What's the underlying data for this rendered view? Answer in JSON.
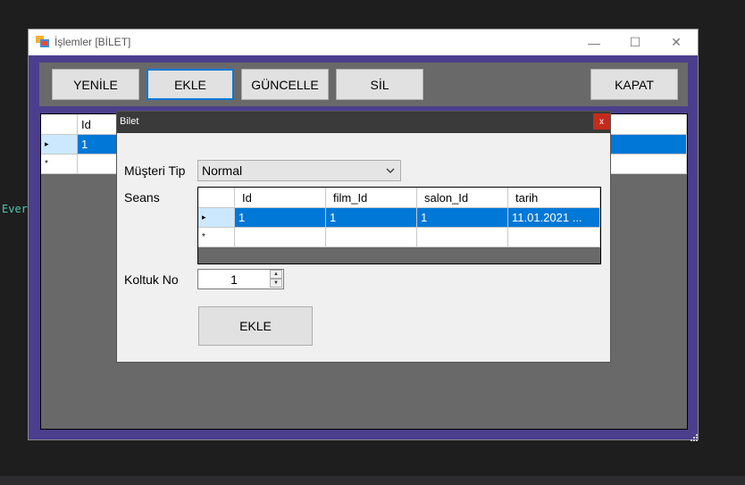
{
  "editor": {
    "snippet": "Ever"
  },
  "window": {
    "title": "İşlemler [BİLET]",
    "minimize": "—",
    "maximize": "☐",
    "close": "✕"
  },
  "toolbar": {
    "yenile": "YENİLE",
    "ekle": "EKLE",
    "guncelle": "GÜNCELLE",
    "sil": "SİL",
    "kapat": "KAPAT"
  },
  "main_grid": {
    "columns": [
      "Id"
    ],
    "rows": [
      [
        "1"
      ]
    ],
    "current_row_marker": "▸",
    "new_row_marker": "*"
  },
  "dialog": {
    "title": "Bilet",
    "close": "x",
    "musteri_label": "Müşteri Tip",
    "musteri_value": "Normal",
    "seans_label": "Seans",
    "seans_grid": {
      "columns": [
        "Id",
        "film_Id",
        "salon_Id",
        "tarih"
      ],
      "rows": [
        [
          "1",
          "1",
          "1",
          "11.01.2021 ..."
        ]
      ],
      "current_row_marker": "▸",
      "new_row_marker": "*"
    },
    "koltuk_label": "Koltuk No",
    "koltuk_value": "1",
    "ekle_button": "EKLE"
  },
  "colors": {
    "accent": "#0078d7",
    "frame": "#4b3e8c",
    "grid_bg": "#696969"
  }
}
